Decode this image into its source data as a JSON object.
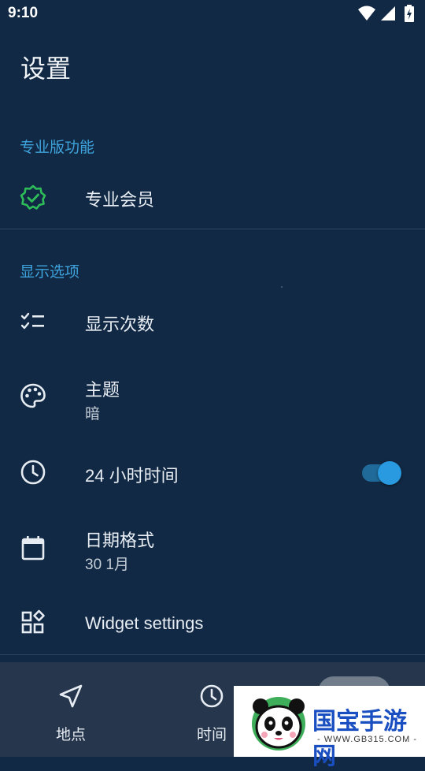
{
  "status_bar": {
    "time": "9:10",
    "icons": [
      "wifi-icon",
      "signal-icon",
      "battery-charging-icon"
    ]
  },
  "page": {
    "title": "设置"
  },
  "sections": {
    "pro": {
      "header": "专业版功能",
      "item": {
        "label": "专业会员",
        "icon": "verified-badge-icon",
        "icon_color": "#2ebd59"
      }
    },
    "display": {
      "header": "显示选项",
      "items": [
        {
          "label": "显示次数",
          "icon": "checklist-icon"
        },
        {
          "label": "主题",
          "sublabel": "暗",
          "icon": "palette-icon"
        },
        {
          "label": "24 小时时间",
          "icon": "clock-icon",
          "toggle_on": true
        },
        {
          "label": "日期格式",
          "sublabel": "30 1月",
          "icon": "calendar-icon"
        },
        {
          "label": "Widget settings",
          "icon": "widgets-icon"
        }
      ]
    }
  },
  "bottom_nav": {
    "items": [
      {
        "label": "地点",
        "icon": "navigation-arrow-icon"
      },
      {
        "label": "时间",
        "icon": "clock-icon"
      }
    ]
  },
  "watermark": {
    "title": "国宝手游网",
    "subtitle": "- WWW.GB315.COM -"
  },
  "colors": {
    "background": "#112944",
    "accent": "#3ea3dc",
    "nav_background": "#25364d",
    "pro_badge": "#2ebd59",
    "toggle": "#2a9ae0"
  }
}
